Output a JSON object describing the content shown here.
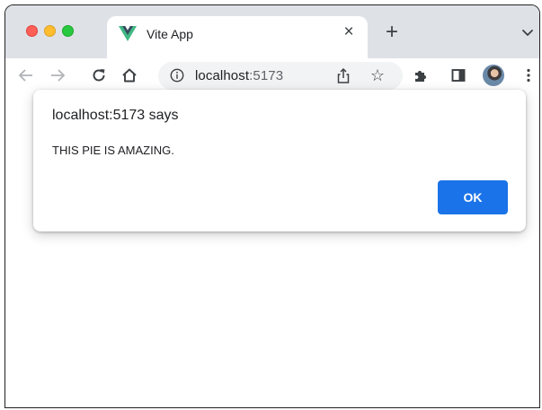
{
  "window_controls": {
    "close_color": "#fe5f57",
    "minimize_color": "#febc2e",
    "zoom_color": "#28c840"
  },
  "tab": {
    "favicon": "vue-logo-icon",
    "title": "Vite App",
    "close_glyph": "×"
  },
  "new_tab_glyph": "+",
  "toolbar": {
    "back_icon": "arrow-left-icon",
    "forward_icon": "arrow-right-icon",
    "reload_icon": "reload-icon",
    "home_icon": "home-icon",
    "site_info_icon": "info-icon",
    "url_host": "localhost",
    "url_port": ":5173",
    "share_icon": "share-icon",
    "bookmark_glyph": "☆",
    "extensions_icon": "puzzle-icon",
    "side_panel_icon": "side-panel-icon",
    "profile_icon": "avatar",
    "menu_icon": "kebab-menu-icon"
  },
  "dialog": {
    "title": "localhost:5173 says",
    "message": "THIS PIE IS AMAZING.",
    "ok_label": "OK"
  },
  "colors": {
    "tabstrip_bg": "#dee1e6",
    "omnibox_bg": "#f1f3f4",
    "ok_button": "#1a73e8"
  }
}
